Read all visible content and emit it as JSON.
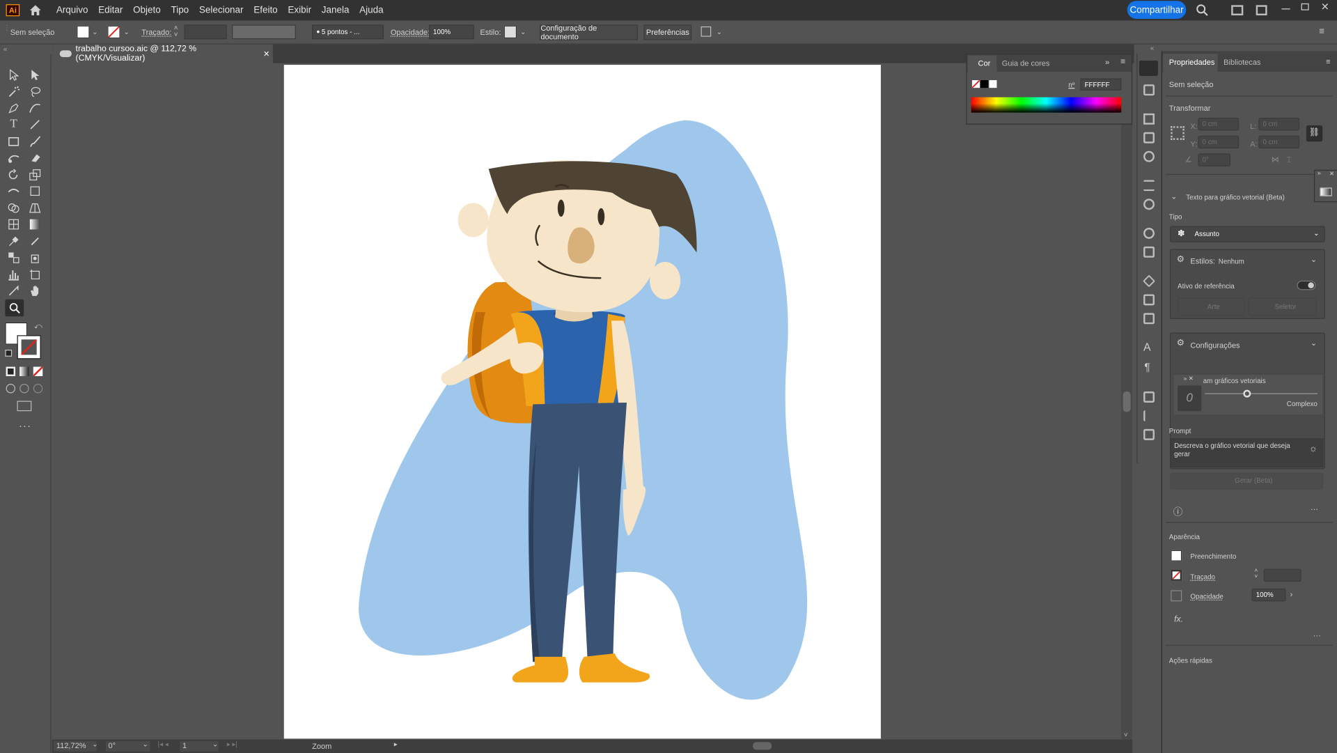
{
  "app": {
    "logo": "Ai",
    "menu": [
      "Arquivo",
      "Editar",
      "Objeto",
      "Tipo",
      "Selecionar",
      "Efeito",
      "Exibir",
      "Janela",
      "Ajuda"
    ],
    "share_label": "Compartilhar"
  },
  "control_bar": {
    "selection": "Sem seleção",
    "stroke_label": "Traçado:",
    "brush": "5 pontos - ...",
    "opacity_label": "Opacidade:",
    "opacity_value": "100%",
    "style_label": "Estilo:",
    "doc_setup": "Configuração de documento",
    "preferences": "Preferências"
  },
  "document": {
    "tab_title": "trabalho cursoo.aic @ 112,72 % (CMYK/Visualizar)",
    "close": "×"
  },
  "status": {
    "zoom": "112,72%",
    "rotation": "0°",
    "page": "1",
    "tool": "Zoom"
  },
  "color_panel": {
    "tabs": [
      "Cor",
      "Guia de cores"
    ],
    "hex_label": "nº",
    "hex_value": "FFFFFF"
  },
  "properties": {
    "tabs": [
      "Propriedades",
      "Bibliotecas"
    ],
    "selection": "Sem seleção",
    "transform_title": "Transformar",
    "x_label": "X:",
    "y_label": "Y:",
    "w_label": "L:",
    "h_label": "A:",
    "x_value": "0 cm",
    "y_value": "0 cm",
    "w_value": "0 cm",
    "h_value": "0 cm",
    "angle_value": "0°",
    "text_to_vector": "Texto para gráfico vetorial (Beta)",
    "type_label": "Tipo",
    "type_value": "Assunto",
    "styles_label": "Estilos:",
    "styles_value": "Nenhum",
    "reference_label": "Ativo de referência",
    "art_label": "Arte",
    "picker_label": "Seletor",
    "settings_label": "Configurações",
    "detail_label": "am gráficos vetoriais",
    "complex_label": "Complexo",
    "prompt_label": "Prompt",
    "prompt_placeholder": "Descreva o gráfico vetorial que deseja gerar",
    "generate_label": "Gerar (Beta)",
    "appearance_title": "Aparência",
    "fill_label": "Preenchimento",
    "stroke_label": "Traçado",
    "opacity_label": "Opacidade",
    "opacity_value": "100%",
    "fx_label": "fx.",
    "quick_actions": "Ações rápidas"
  },
  "colors": {
    "accent": "#1473e6",
    "blob": "#9fc7eb",
    "hair": "#4f4334",
    "skin": "#f6e5c8",
    "shirt": "#2b63ac",
    "pants": "#3a5274",
    "backpack": "#e88e12",
    "shoes": "#f2a51b"
  }
}
